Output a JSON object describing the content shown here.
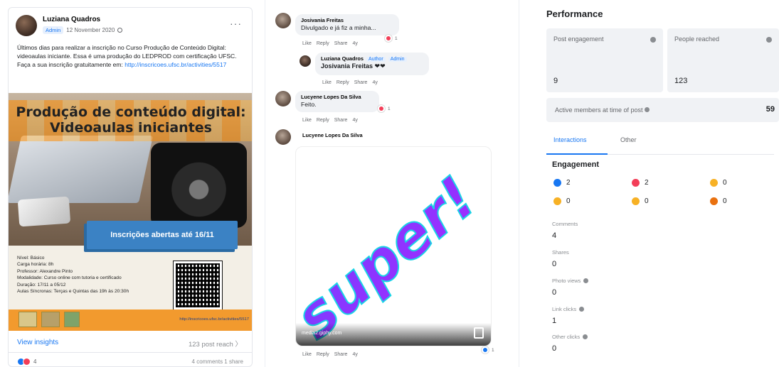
{
  "post": {
    "author": "Luziana Quadros",
    "role_badge": "Admin",
    "date": "12 November 2020",
    "text": "Últimos dias para realizar a inscrição no Curso Produção de Conteúdo Digital: videoaulas iniciante. Essa é uma produção do LEDPROD com certificação UFSC. Faça a sua inscrição gratuitamente em: ",
    "link": "http://inscricoes.ufsc.br/activities/5517",
    "banner": {
      "title": "Produção de conteúdo digital: Videoaulas iniciantes",
      "cta": "Inscrições abertas até 16/11",
      "info_lines": [
        "Nível: Básico",
        "Carga horária: 8h",
        "Professor: Alexandre Pinto",
        "Modalidade: Curso online com tutoria e certificado",
        "Duração: 17/11 a 05/12",
        "Aulas Síncronas: Terças e Quintas das 19h às 20:30h"
      ],
      "url": "http://inscricoes.ufsc.br/activities/5517"
    },
    "view_insights": "View insights",
    "reach": "123 post reach",
    "reaction_count": "4",
    "counts": "4 comments  1 share"
  },
  "comments": {
    "c1": {
      "name": "Josivania Freitas",
      "text": "Divulgado e já fiz a minha...",
      "react": "1"
    },
    "c2": {
      "name": "Luziana Quadros",
      "tag1": "Author",
      "tag2": "Admin",
      "text": "Josivania Freitas ❤❤"
    },
    "c3": {
      "name": "Lucyene Lopes Da Silva",
      "text": "Feito.",
      "react": "1"
    },
    "c4": {
      "name": "Lucyene Lopes Da Silva",
      "gif_word": "super!",
      "gif_url": "media2.giphy.com",
      "react": "1"
    },
    "actions": {
      "like": "Like",
      "reply": "Reply",
      "share": "Share",
      "time": "4y"
    }
  },
  "performance": {
    "title": "Performance",
    "post_engagement_label": "Post engagement",
    "post_engagement_value": "9",
    "people_reached_label": "People reached",
    "people_reached_value": "123",
    "active_members_label": "Active members at time of post",
    "active_members_value": "59",
    "tab_interactions": "Interactions",
    "tab_other": "Other",
    "engagement_title": "Engagement",
    "reactions": [
      {
        "emoji": "like",
        "value": "2"
      },
      {
        "emoji": "love",
        "value": "2"
      },
      {
        "emoji": "haha",
        "value": "0"
      },
      {
        "emoji": "wow",
        "value": "0"
      },
      {
        "emoji": "sad",
        "value": "0"
      },
      {
        "emoji": "angry",
        "value": "0"
      }
    ],
    "metrics": [
      {
        "label": "Comments",
        "value": "4",
        "info": false
      },
      {
        "label": "Shares",
        "value": "0",
        "info": false
      },
      {
        "label": "Photo views",
        "value": "0",
        "info": true
      },
      {
        "label": "Link clicks",
        "value": "1",
        "info": true
      },
      {
        "label": "Other clicks",
        "value": "0",
        "info": true
      }
    ],
    "colors": {
      "like": "#1877f2",
      "love": "#f33e58",
      "haha": "#f7b125",
      "wow": "#f7b125",
      "sad": "#f7b125",
      "angry": "#e9710f"
    }
  }
}
